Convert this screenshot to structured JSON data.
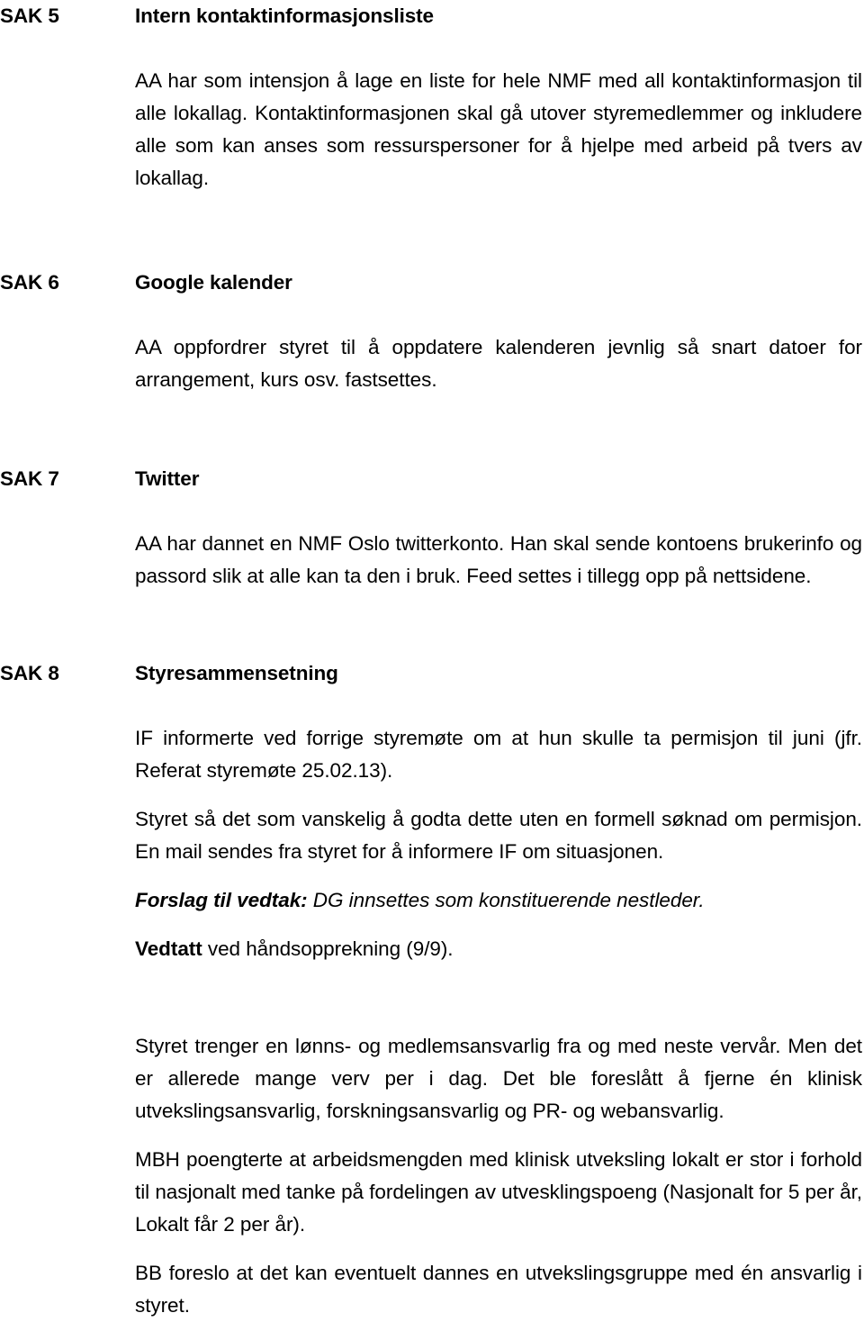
{
  "document": {
    "language": "no",
    "text_color": "#000000",
    "background_color": "#ffffff"
  },
  "items": [
    {
      "label": "SAK 5",
      "title": "Intern kontaktinformasjonsliste",
      "paragraphs": [
        "AA har som intensjon å lage en liste for hele NMF med all kontaktinformasjon til alle lokallag. Kontaktinformasjonen skal gå utover styremedlemmer og inkludere alle som kan anses som ressurspersoner for å hjelpe med arbeid på tvers av lokallag."
      ]
    },
    {
      "label": "SAK 6",
      "title": "Google kalender",
      "paragraphs": [
        "AA oppfordrer styret til å oppdatere kalenderen jevnlig så snart datoer for arrangement, kurs osv. fastsettes."
      ]
    },
    {
      "label": "SAK 7",
      "title": "Twitter",
      "paragraphs": [
        "AA har dannet en NMF Oslo twitterkonto. Han skal sende kontoens brukerinfo og passord slik at alle kan ta den i bruk. Feed settes i tillegg opp på nettsidene."
      ]
    },
    {
      "label": "SAK 8",
      "title": "Styresammensetning",
      "paragraphs": [
        "IF informerte ved forrige styremøte om at hun skulle ta permisjon til juni (jfr. Referat styremøte 25.02.13).",
        "Styret så det som vanskelig å godta dette uten en formell søknad om permisjon. En mail sendes fra styret for å informere IF om situasjonen."
      ],
      "proposal": {
        "lead": "Forslag til vedtak:",
        "rest": " DG innsettes som konstituerende nestleder."
      },
      "resolution": {
        "lead": "Vedtatt",
        "rest": " ved håndsopprekning (9/9)."
      },
      "discussion": [
        "Styret trenger en lønns- og medlemsansvarlig fra og med neste vervår. Men det er allerede mange verv per i dag. Det ble foreslått å fjerne én klinisk utvekslingsansvarlig, forskningsansvarlig og PR- og webansvarlig.",
        "MBH poengterte at arbeidsmengden med klinisk utveksling lokalt er stor i forhold til nasjonalt med tanke på fordelingen av utvesklingspoeng (Nasjonalt for 5 per år, Lokalt får 2 per år).",
        "BB foreslo at det kan eventuelt dannes en utvekslingsgruppe med én ansvarlig i styret."
      ]
    }
  ]
}
